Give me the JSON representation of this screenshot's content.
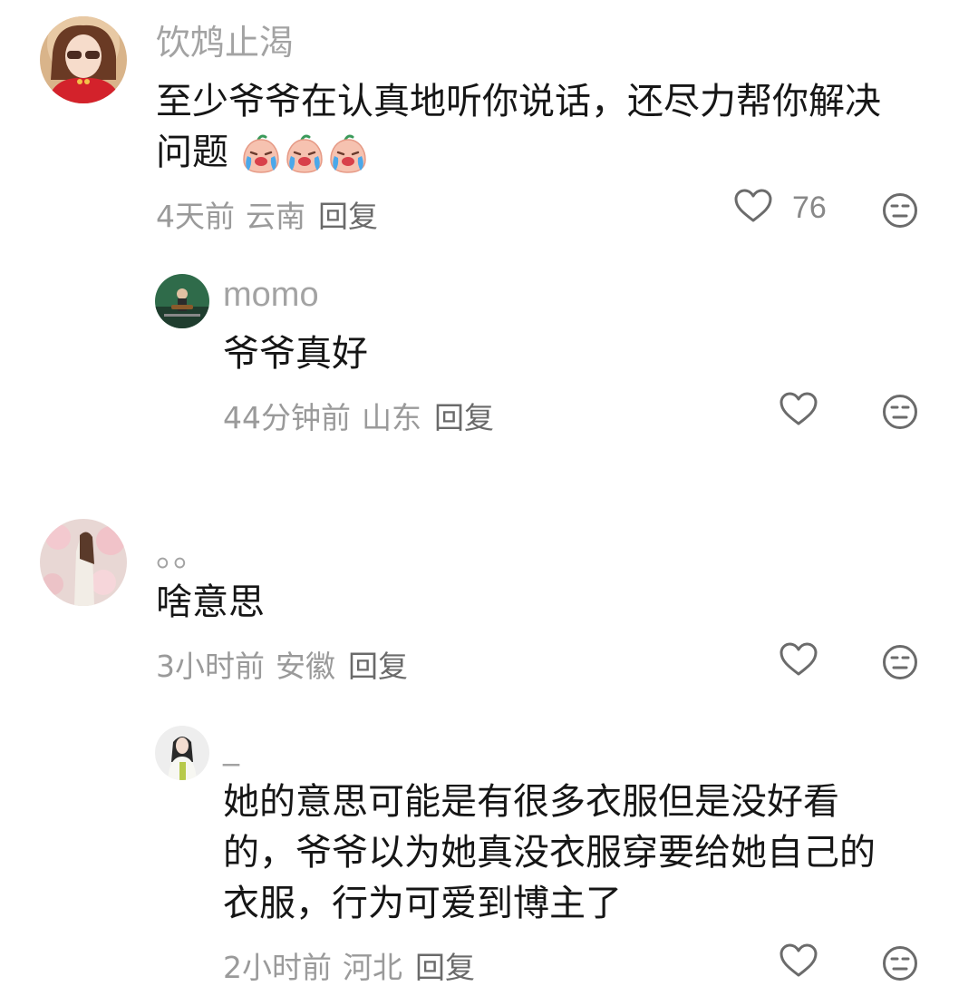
{
  "comments": [
    {
      "username": "饮鸩止渴",
      "text": "至少爷爷在认真地听你说话，还尽力帮你解决问题",
      "text_line1": "至少爷爷在认真地听你说话，还尽力帮你解决",
      "text_line2": "问题",
      "emoji": "crying-face-emoji",
      "emoji_count": 3,
      "time": "4天前",
      "region": "云南",
      "reply_label": "回复",
      "likes": "76",
      "avatar": "avatar-girl-red-dress"
    },
    {
      "username": "momo",
      "text": "爷爷真好",
      "time": "44分钟前",
      "region": "山东",
      "reply_label": "回复",
      "avatar": "avatar-guitar-stage"
    },
    {
      "username": "。。",
      "text": "啥意思",
      "time": "3小时前",
      "region": "安徽",
      "reply_label": "回复",
      "avatar": "avatar-blossom-girl"
    },
    {
      "username": "_",
      "text_line1": "她的意思可能是有很多衣服但是没好看",
      "text_line2": "的，爷爷以为她真没衣服穿要给她自己的",
      "text_line3": "衣服，行为可爱到博主了",
      "time": "2小时前",
      "region": "河北",
      "reply_label": "回复",
      "avatar": "avatar-white-coat-girl"
    }
  ],
  "icons": {
    "like": "heart-outline-icon",
    "dislike": "meh-face-icon"
  },
  "colors": {
    "username": "#a3a3a3",
    "text": "#161616",
    "meta": "#9a9a9a",
    "icon": "#6b6b6b"
  }
}
